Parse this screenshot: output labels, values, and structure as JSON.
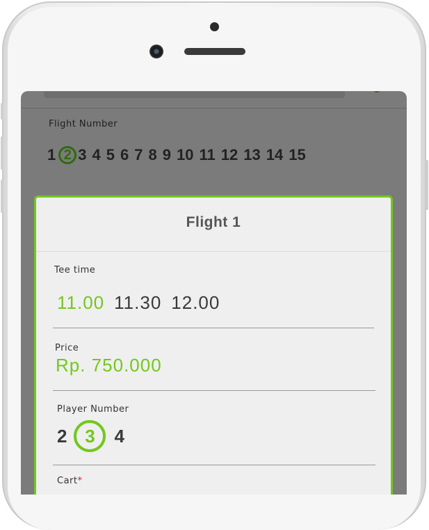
{
  "flight_number": {
    "label": "Flight Number",
    "numbers": [
      "1",
      "2",
      "3",
      "4",
      "5",
      "6",
      "7",
      "8",
      "9",
      "10",
      "11",
      "12",
      "13",
      "14",
      "15"
    ],
    "selected": "2"
  },
  "modal": {
    "title": "Flight 1",
    "tee_time": {
      "label": "Tee time",
      "options": [
        "11.00",
        "11.30",
        "12.00"
      ],
      "selected": "11.00"
    },
    "price": {
      "label": "Price",
      "value": "Rp. 750.000"
    },
    "player_number": {
      "label": "Player Number",
      "options": [
        "2",
        "3",
        "4"
      ],
      "selected": "3"
    },
    "cart": {
      "label": "Cart",
      "required_mark": "*"
    }
  },
  "colors": {
    "accent": "#72c81c",
    "selected_dark": "#2f6b12",
    "overlay": "#7b7b7b",
    "required": "#e01b1b"
  },
  "icons": {
    "top_right": "check-icon"
  }
}
